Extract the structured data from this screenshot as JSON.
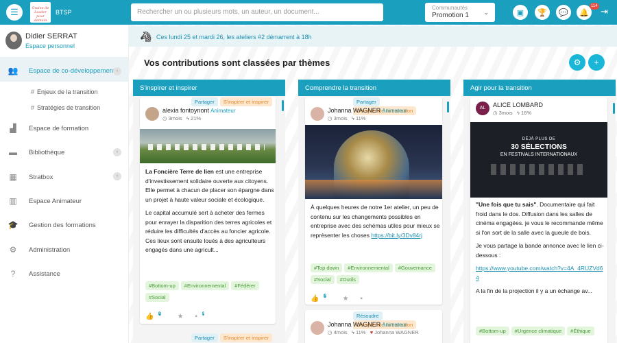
{
  "topbar": {
    "org": "BTSP",
    "logo_text": "Graine de Leader pour demain",
    "search_placeholder": "Rechercher un ou plusieurs mots, un auteur, un document...",
    "community_label": "Communautés",
    "community_value": "Promotion 1",
    "notification_count": "114",
    "icons": [
      "presentation-icon",
      "trophy-icon",
      "chat-icon",
      "bell-icon",
      "logout-icon"
    ]
  },
  "user": {
    "name": "Didier SERRAT",
    "space": "Espace personnel"
  },
  "sidebar": {
    "items": [
      {
        "label": "Espace de co-développement",
        "icon": "users-icon",
        "active": true
      },
      {
        "label": "Espace de formation",
        "icon": "factory-icon"
      },
      {
        "label": "Bibliothèque",
        "icon": "folder-icon"
      },
      {
        "label": "Stratbox",
        "icon": "grid-icon"
      },
      {
        "label": "Espace Animateur",
        "icon": "table-icon"
      },
      {
        "label": "Gestion des formations",
        "icon": "graduation-icon"
      },
      {
        "label": "Administration",
        "icon": "gear-icon"
      },
      {
        "label": "Assistance",
        "icon": "help-icon"
      }
    ],
    "subitems": [
      "Enjeux de la transition",
      "Stratégies de transition"
    ]
  },
  "notice": "Ces lundi 25 et mardi 26, les ateliers #2 démarrent à 18h",
  "page_title": "Vos contributions sont classées par thèmes",
  "columns": [
    {
      "title": "S'inspirer et inspirer",
      "card": {
        "tags": [
          "Partager",
          "S'inspirer et inspirer"
        ],
        "author": "alexia fontoynont",
        "role": "Animateur",
        "time": "3mois",
        "score": "21%",
        "bold": "La Foncière Terre de lien",
        "p1": " est une entreprise d'investissement solidaire ouverte aux citoyens. Elle permet à chacun de placer son épargne dans un projet à haute valeur sociale et écologique.",
        "p2": "Le capital accumulé sert à acheter des fermes pour enrayer la disparition des terres agricoles et réduire les difficultés d'accès au foncier agricole. Ces lieux sont ensuite loués à des agriculteurs engagés dans une agricult...",
        "hashtags": [
          "#Bottom-up",
          "#Environnemental",
          "#Fédérer",
          "#Social"
        ],
        "likes": "4",
        "comments": "3"
      },
      "next_tags": [
        "Partager",
        "S'inspirer et inspirer"
      ]
    },
    {
      "title": "Comprendre la transition",
      "card": {
        "tags": [
          "Partager",
          "Comprendre la transition"
        ],
        "author": "Johanna WAGNER",
        "role": "Animateur",
        "time": "3mois",
        "score": "11%",
        "p1": "À quelques heures de notre 1er atelier, un peu de contenu sur les changements possibles en entreprise avec des schémas utiles pour mieux se représenter les choses ",
        "link": "https://bit.ly/3Dv84rj",
        "hashtags": [
          "#Top down",
          "#Environnemental",
          "#Gouvernance",
          "#Social",
          "#Outils"
        ],
        "likes": "3"
      },
      "next": {
        "tags": [
          "Résoudre",
          "Comprendre la transition"
        ],
        "author": "Johanna WAGNER",
        "role": "Animateur",
        "time": "4mois",
        "score": "11%",
        "liked_by": "Johanna WAGNER"
      }
    },
    {
      "title": "Agir pour la transition",
      "card": {
        "initials": "AL",
        "author": "ALICE LOMBARD",
        "time": "3mois",
        "score": "16%",
        "poster_small": "DÉJÀ PLUS DE",
        "poster_big": "30 SÉLECTIONS",
        "poster_sub": "EN FESTIVALS INTERNATIONAUX",
        "bold": "\"Une fois que tu sais\"",
        "p1": ". Documentaire qui fait froid dans le dos. Diffusion dans les salles de cinéma engagées. je vous le recommande même si l'on sort de la salle avec la gueule de bois.",
        "p2": "Je vous partage la bande annonce avec le lien ci-dessous :",
        "link": "https://www.youtube.com/watch?v=4A_4RUZVd64",
        "p3": "A la fin de la projection il y a un échange av...",
        "hashtags": [
          "#Bottom-up",
          "#Urgence climatique",
          "#Éthique"
        ]
      }
    }
  ]
}
